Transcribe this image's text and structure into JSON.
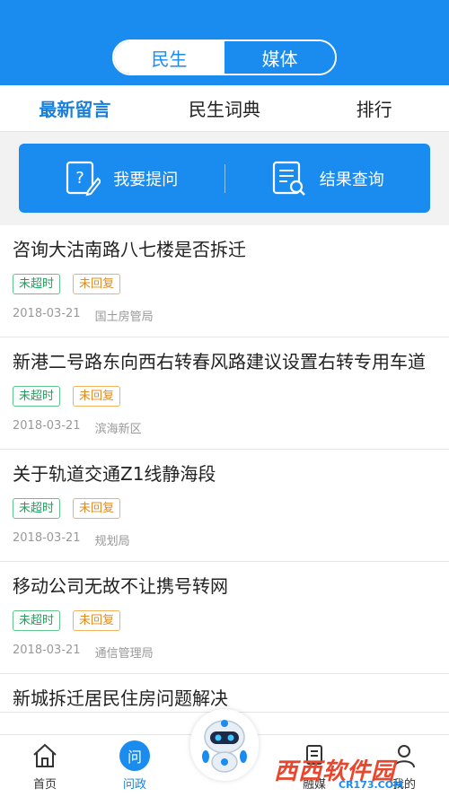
{
  "header": {
    "segments": [
      {
        "label": "民生",
        "active": true
      },
      {
        "label": "媒体",
        "active": false
      }
    ]
  },
  "tabs": [
    {
      "label": "最新留言",
      "active": true
    },
    {
      "label": "民生词典",
      "active": false
    },
    {
      "label": "排行",
      "active": false
    }
  ],
  "actions": {
    "ask_label": "我要提问",
    "ask_icon": "question-doc-icon",
    "query_label": "结果查询",
    "query_icon": "search-doc-icon"
  },
  "messages": [
    {
      "title": "咨询大沽南路八七楼是否拆迁",
      "status1": "未超时",
      "status2": "未回复",
      "date": "2018-03-21",
      "dept": "国土房管局"
    },
    {
      "title": "新港二号路东向西右转春风路建议设置右转专用车道",
      "status1": "未超时",
      "status2": "未回复",
      "date": "2018-03-21",
      "dept": "滨海新区"
    },
    {
      "title": "关于轨道交通Z1线静海段",
      "status1": "未超时",
      "status2": "未回复",
      "date": "2018-03-21",
      "dept": "规划局"
    },
    {
      "title": "移动公司无故不让携号转网",
      "status1": "未超时",
      "status2": "未回复",
      "date": "2018-03-21",
      "dept": "通信管理局"
    },
    {
      "title": "新城拆迁居民住房问题解决",
      "status1": "",
      "status2": "",
      "date": "",
      "dept": ""
    }
  ],
  "bottom_nav": [
    {
      "label": "首页",
      "icon": "home-icon",
      "active": false
    },
    {
      "label": "问政",
      "icon": "wen-icon",
      "icon_text": "问",
      "active": true
    },
    {
      "label": "",
      "icon": "robot-icon",
      "active": false
    },
    {
      "label": "融媒",
      "icon": "media-icon",
      "active": false
    },
    {
      "label": "我的",
      "icon": "profile-icon",
      "active": false
    }
  ],
  "watermark": {
    "main": "西西软件园",
    "sub": "CR173.COM"
  },
  "colors": {
    "brand": "#1a8cf0",
    "active_text": "#1a7fd8",
    "tag_green": "#19a35a",
    "tag_orange": "#e58a1d"
  }
}
